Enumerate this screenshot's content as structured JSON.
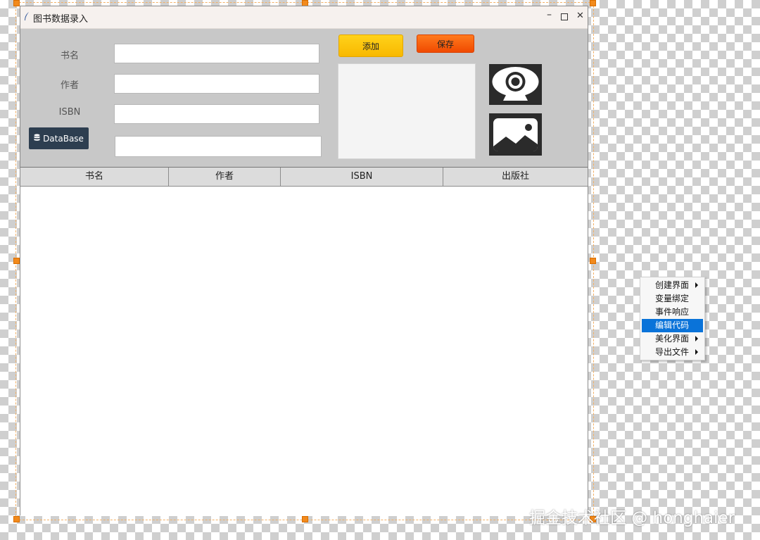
{
  "window": {
    "title": "图书数据录入",
    "minimize": "–",
    "close": "✕"
  },
  "form": {
    "labels": {
      "book_name": "书名",
      "author": "作者",
      "isbn": "ISBN"
    },
    "values": {
      "book_name": "",
      "author": "",
      "isbn": "",
      "database_path": ""
    },
    "database_button": "DataBase",
    "add_button": "添加",
    "save_button": "保存"
  },
  "table": {
    "columns": [
      "书名",
      "作者",
      "ISBN",
      "出版社"
    ],
    "rows": []
  },
  "context_menu": {
    "items": [
      {
        "label": "创建界面",
        "submenu": true
      },
      {
        "label": "变量绑定",
        "submenu": false
      },
      {
        "label": "事件响应",
        "submenu": false
      },
      {
        "label": "编辑代码",
        "submenu": false,
        "highlighted": true
      },
      {
        "label": "美化界面",
        "submenu": true
      },
      {
        "label": "导出文件",
        "submenu": true
      }
    ]
  },
  "watermark": "掘金技术社区 @ honghaier",
  "colors": {
    "add_button": "#f8c000",
    "save_button": "#f25a0a",
    "database_button": "#2d3e50",
    "menu_highlight": "#0a73d9",
    "selection_handle": "#f28a1c"
  },
  "icons": {
    "camera": "camera-icon",
    "image": "image-icon",
    "database": "database-icon",
    "feather": "feather-icon"
  }
}
